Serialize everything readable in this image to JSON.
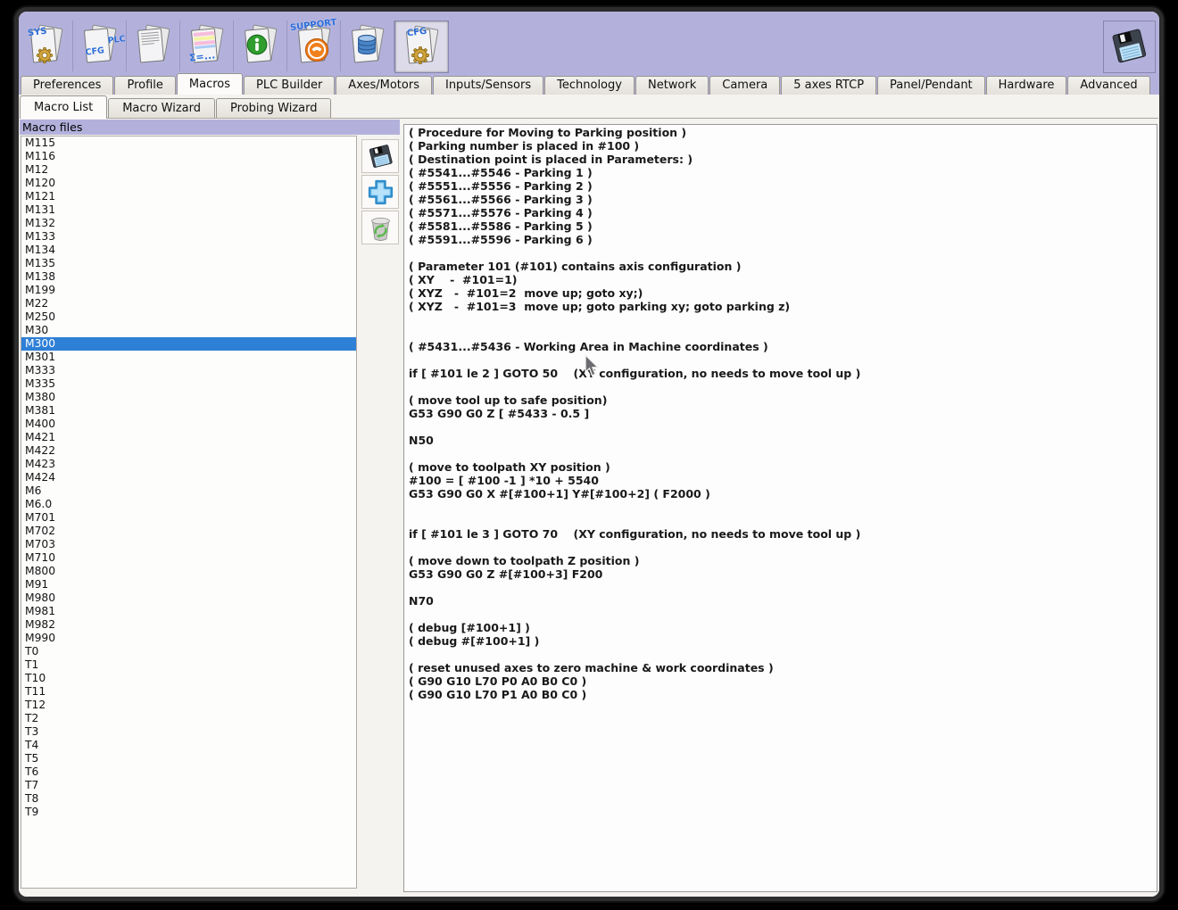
{
  "toolbar": {
    "sys_label": "SYS",
    "plc_label_line1": "PLC",
    "plc_label_line2": "CFG",
    "report_label": "Σ=...",
    "support_label": "SUPPORT",
    "cfg_label": "CFG"
  },
  "tabs": [
    {
      "label": "Preferences"
    },
    {
      "label": "Profile"
    },
    {
      "label": "Macros",
      "active": true
    },
    {
      "label": "PLC Builder"
    },
    {
      "label": "Axes/Motors"
    },
    {
      "label": "Inputs/Sensors"
    },
    {
      "label": "Technology"
    },
    {
      "label": "Network"
    },
    {
      "label": "Camera"
    },
    {
      "label": "5 axes RTCP"
    },
    {
      "label": "Panel/Pendant"
    },
    {
      "label": "Hardware"
    },
    {
      "label": "Advanced"
    }
  ],
  "subtabs": [
    {
      "label": "Macro List",
      "active": true
    },
    {
      "label": "Macro Wizard"
    },
    {
      "label": "Probing Wizard"
    }
  ],
  "macro_panel": {
    "header": "Macro files",
    "selected": "M300",
    "items": [
      "M115",
      "M116",
      "M12",
      "M120",
      "M121",
      "M131",
      "M132",
      "M133",
      "M134",
      "M135",
      "M138",
      "M199",
      "M22",
      "M250",
      "M30",
      "M300",
      "M301",
      "M333",
      "M335",
      "M380",
      "M381",
      "M400",
      "M421",
      "M422",
      "M423",
      "M424",
      "M6",
      "M6.0",
      "M701",
      "M702",
      "M703",
      "M710",
      "M800",
      "M91",
      "M980",
      "M981",
      "M982",
      "M990",
      "T0",
      "T1",
      "T10",
      "T11",
      "T12",
      "T2",
      "T3",
      "T4",
      "T5",
      "T6",
      "T7",
      "T8",
      "T9"
    ]
  },
  "editor": {
    "lines": [
      "( Procedure for Moving to Parking position )",
      "( Parking number is placed in #100 )",
      "( Destination point is placed in Parameters: )",
      "( #5541...#5546 - Parking 1 )",
      "( #5551...#5556 - Parking 2 )",
      "( #5561...#5566 - Parking 3 )",
      "( #5571...#5576 - Parking 4 )",
      "( #5581...#5586 - Parking 5 )",
      "( #5591...#5596 - Parking 6 )",
      "",
      "( Parameter 101 (#101) contains axis configuration )",
      "( XY    -  #101=1)",
      "( XYZ   -  #101=2  move up; goto xy;)",
      "( XYZ   -  #101=3  move up; goto parking xy; goto parking z)",
      "",
      "",
      "( #5431...#5436 - Working Area in Machine coordinates )",
      "",
      "if [ #101 le 2 ] GOTO 50    (XY configuration, no needs to move tool up )",
      "",
      "( move tool up to safe position)",
      "G53 G90 G0 Z [ #5433 - 0.5 ]",
      "",
      "N50",
      "",
      "( move to toolpath XY position )",
      "#100 = [ #100 -1 ] *10 + 5540",
      "G53 G90 G0 X #[#100+1] Y#[#100+2] ( F2000 )",
      "",
      "",
      "if [ #101 le 3 ] GOTO 70    (XY configuration, no needs to move tool up )",
      "",
      "( move down to toolpath Z position )",
      "G53 G90 G0 Z #[#100+3] F200",
      "",
      "N70",
      "",
      "( debug [#100+1] )",
      "( debug #[#100+1] )",
      "",
      "( reset unused axes to zero machine & work coordinates )",
      "( G90 G10 L70 P0 A0 B0 C0 )",
      "( G90 G10 L70 P1 A0 B0 C0 )"
    ]
  },
  "colors": {
    "toolbar_lavender": "#b3b1dc",
    "selection_blue": "#2e7fd6",
    "page_background": "#f5f3f0",
    "window_frame": "#2d2d2d"
  }
}
